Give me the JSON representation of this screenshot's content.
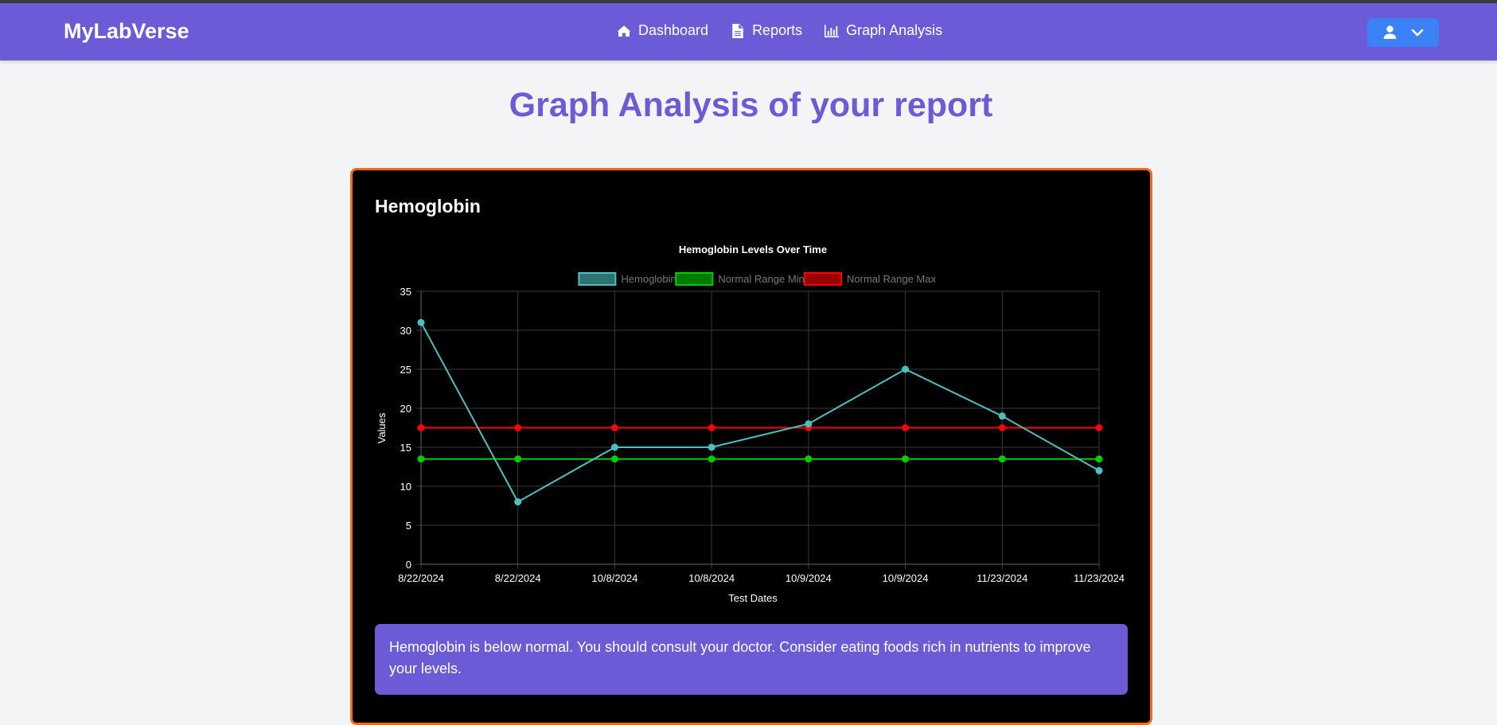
{
  "app": {
    "brand": "MyLabVerse"
  },
  "nav": {
    "items": [
      {
        "label": "Dashboard",
        "icon": "home-icon"
      },
      {
        "label": "Reports",
        "icon": "file-icon"
      },
      {
        "label": "Graph Analysis",
        "icon": "chart-icon"
      }
    ]
  },
  "user_menu": {
    "icon": "user-icon",
    "caret": "chevron-down-icon"
  },
  "page": {
    "title": "Graph Analysis of your report"
  },
  "card": {
    "title": "Hemoglobin",
    "advice": "Hemoglobin is below normal. You should consult your doctor. Consider eating foods rich in nutrients to improve your levels."
  },
  "colors": {
    "brand": "#6c5bd6",
    "card_border": "#f26a1b",
    "user_button": "#3b82f6",
    "hemoglobin": "#4bc0c0",
    "normal_min": "#00cc00",
    "normal_max": "#ff0000"
  },
  "chart_data": {
    "type": "line",
    "title": "Hemoglobin Levels Over Time",
    "xlabel": "Test Dates",
    "ylabel": "Values",
    "categories": [
      "8/22/2024",
      "8/22/2024",
      "10/8/2024",
      "10/8/2024",
      "10/9/2024",
      "10/9/2024",
      "11/23/2024",
      "11/23/2024"
    ],
    "ylim": [
      0,
      35
    ],
    "yticks": [
      0,
      5,
      10,
      15,
      20,
      25,
      30,
      35
    ],
    "grid": true,
    "legend_position": "top",
    "series": [
      {
        "name": "Hemoglobin",
        "values": [
          31,
          8,
          15,
          15,
          18,
          25,
          19,
          12
        ],
        "color": "#4bc0c0"
      },
      {
        "name": "Normal Range Min",
        "values": [
          13.5,
          13.5,
          13.5,
          13.5,
          13.5,
          13.5,
          13.5,
          13.5
        ],
        "color": "#00cc00"
      },
      {
        "name": "Normal Range Max",
        "values": [
          17.5,
          17.5,
          17.5,
          17.5,
          17.5,
          17.5,
          17.5,
          17.5
        ],
        "color": "#ff0000"
      }
    ]
  }
}
